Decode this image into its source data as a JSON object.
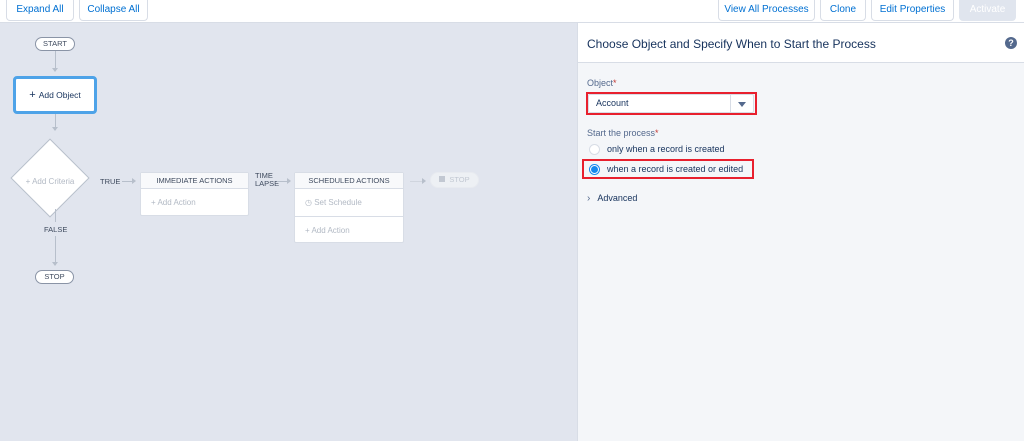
{
  "toolbar": {
    "expand_all": "Expand All",
    "collapse_all": "Collapse All",
    "view_all_processes": "View All Processes",
    "clone": "Clone",
    "edit_properties": "Edit Properties",
    "activate": "Activate"
  },
  "canvas": {
    "start": "START",
    "add_object": "Add Object",
    "add_criteria": "Add Criteria",
    "true_label": "TRUE",
    "false_label": "FALSE",
    "stop": "STOP",
    "immediate_actions": {
      "title": "IMMEDIATE ACTIONS",
      "add_action": "Add Action"
    },
    "time_lapse_line1": "TIME",
    "time_lapse_line2": "LAPSE",
    "scheduled_actions": {
      "title": "SCHEDULED ACTIONS",
      "set_schedule": "Set Schedule",
      "add_action": "Add Action"
    },
    "stop_disabled": "STOP"
  },
  "panel": {
    "title": "Choose Object and Specify When to Start the Process",
    "help_icon": "?",
    "object_label": "Object",
    "required_mark": "*",
    "object_value": "Account",
    "start_label": "Start the process",
    "options": [
      {
        "label": "only when a record is created",
        "selected": false
      },
      {
        "label": "when a record is created or edited",
        "selected": true
      }
    ],
    "advanced": "Advanced"
  },
  "colors": {
    "accent": "#0070d2",
    "highlight": "#e8202e",
    "selected_node": "#4ea3e8",
    "canvas_bg": "#e1e5ee"
  }
}
